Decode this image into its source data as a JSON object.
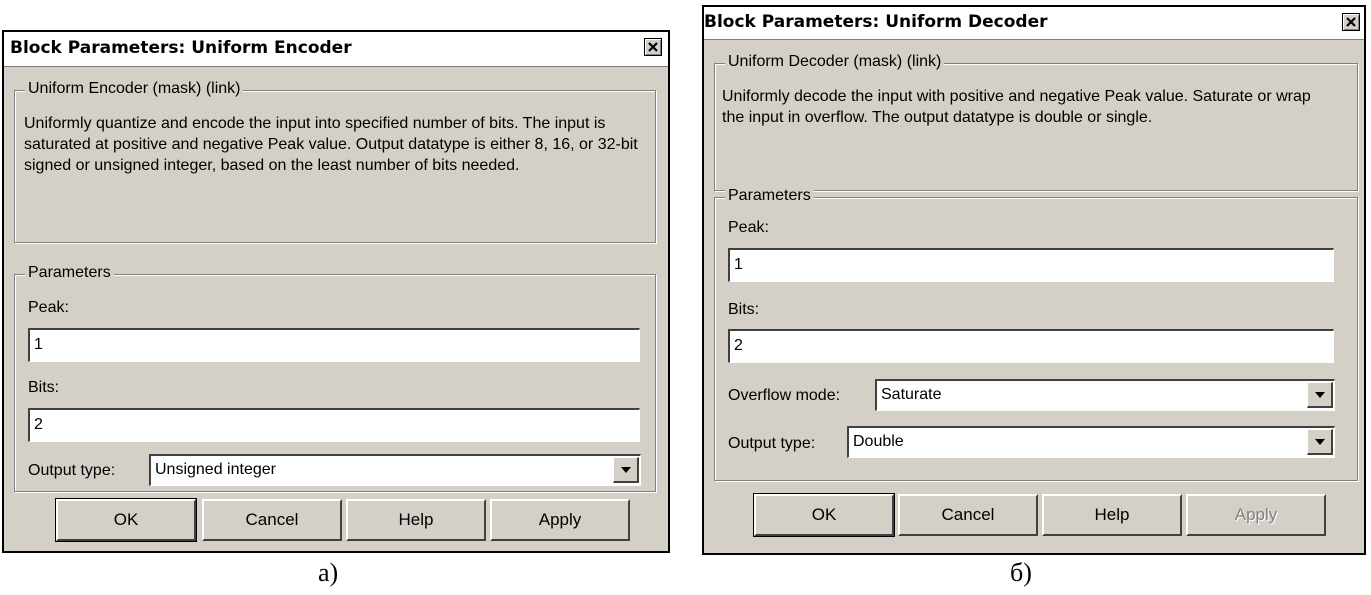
{
  "dialogs": [
    {
      "title": "Block Parameters: Uniform Encoder",
      "mask_group": "Uniform Encoder (mask) (link)",
      "description": "Uniformly quantize and encode the input into specified number of bits. The input is saturated at positive and negative Peak value. Output datatype is either 8, 16, or 32-bit signed or unsigned integer, based on the least number of bits needed.",
      "params_group": "Parameters",
      "peak_label": "Peak:",
      "peak_value": "1",
      "bits_label": "Bits:",
      "bits_value": "2",
      "output_type_label": "Output type:",
      "output_type_value": "Unsigned integer",
      "buttons": {
        "ok": "OK",
        "cancel": "Cancel",
        "help": "Help",
        "apply": "Apply"
      },
      "caption": "а)"
    },
    {
      "title": "Block Parameters: Uniform Decoder",
      "mask_group": "Uniform Decoder (mask) (link)",
      "description": "Uniformly decode the input with positive and negative Peak value. Saturate or wrap the input in overflow.  The  output datatype is double or single.",
      "params_group": "Parameters",
      "peak_label": "Peak:",
      "peak_value": "1",
      "bits_label": "Bits:",
      "bits_value": "2",
      "overflow_label": "Overflow mode:",
      "overflow_value": "Saturate",
      "output_type_label": "Output type:",
      "output_type_value": "Double",
      "buttons": {
        "ok": "OK",
        "cancel": "Cancel",
        "help": "Help",
        "apply": "Apply"
      },
      "apply_enabled": false,
      "caption": "б)"
    }
  ],
  "icons": {
    "close": "close-icon",
    "dropdown": "chevron-down-icon"
  }
}
